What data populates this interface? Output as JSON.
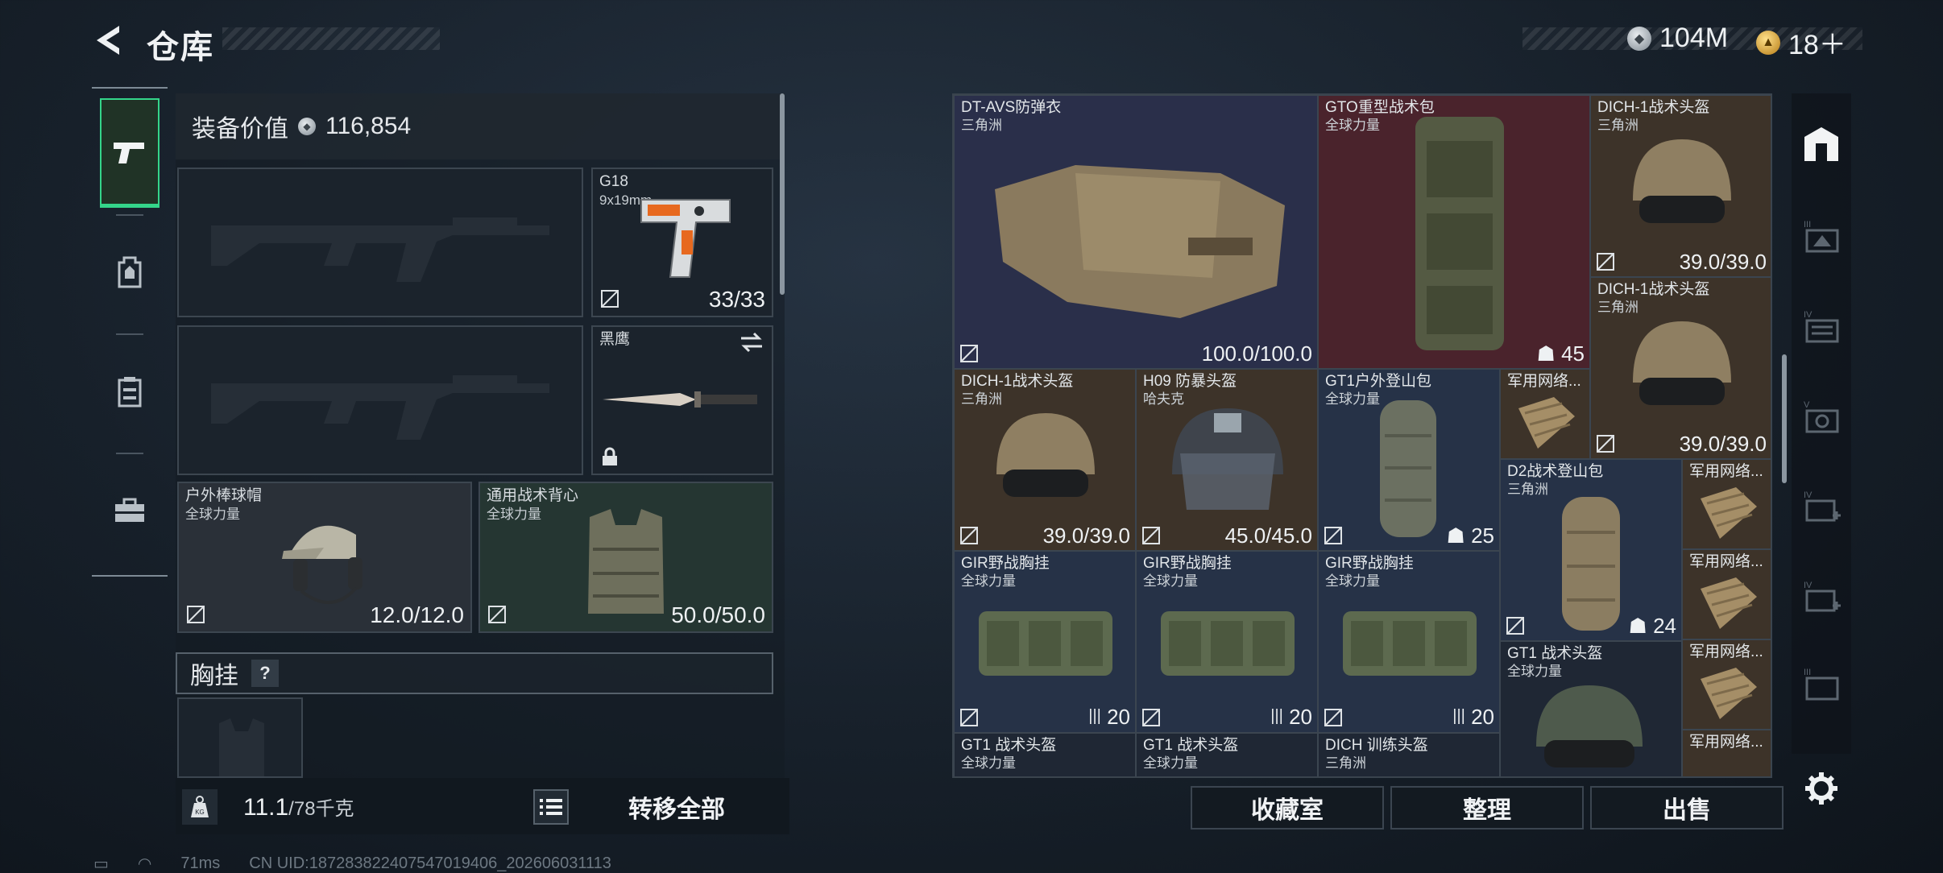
{
  "header": {
    "title": "仓库",
    "currency": [
      {
        "icon": "silver-coin-icon",
        "value": "104M"
      },
      {
        "icon": "gold-coin-icon",
        "value": "18＋"
      }
    ]
  },
  "left_nav": {
    "items": [
      {
        "name": "pistol-icon",
        "active": true
      },
      {
        "name": "backpack-icon",
        "active": false
      },
      {
        "name": "tactical-rig-icon",
        "active": false
      },
      {
        "name": "toolbox-icon",
        "active": false
      }
    ]
  },
  "equipment": {
    "value_label": "装备价值",
    "value": "116,854",
    "pistol": {
      "name": "G18",
      "ammo": "9x19mm",
      "count": "33/33"
    },
    "melee": {
      "name": "黑鹰"
    },
    "helmet": {
      "name": "户外棒球帽",
      "source": "全球力量",
      "durability": "12.0/12.0"
    },
    "armor": {
      "name": "通用战术背心",
      "source": "全球力量",
      "durability": "50.0/50.0"
    },
    "chest_label": "胸挂",
    "chest_help": "?",
    "weight": "11.1",
    "weight_max": "/78千克",
    "transfer_all": "转移全部"
  },
  "inventory": {
    "items": [
      {
        "name": "DT-AVS防弹衣",
        "source": "三角洲",
        "value": "100.0/100.0"
      },
      {
        "name": "GTO重型战术包",
        "source": "全球力量",
        "value": "45"
      },
      {
        "name": "DICH-1战术头盔",
        "source": "三角洲",
        "value": "39.0/39.0"
      },
      {
        "name": "DICH-1战术头盔",
        "source": "三角洲",
        "value": "39.0/39.0"
      },
      {
        "name": "DICH-1战术头盔",
        "source": "三角洲",
        "value": "39.0/39.0"
      },
      {
        "name": "H09 防暴头盔",
        "source": "哈夫克",
        "value": "45.0/45.0"
      },
      {
        "name": "GT1户外登山包",
        "source": "全球力量",
        "value": "25"
      },
      {
        "name": "军用网络...",
        "source": "",
        "value": ""
      },
      {
        "name": "D2战术登山包",
        "source": "三角洲",
        "value": "24"
      },
      {
        "name": "军用网络...",
        "source": "",
        "value": ""
      },
      {
        "name": "GIR野战胸挂",
        "source": "全球力量",
        "value": "20"
      },
      {
        "name": "GIR野战胸挂",
        "source": "全球力量",
        "value": "20"
      },
      {
        "name": "GIR野战胸挂",
        "source": "全球力量",
        "value": "20"
      },
      {
        "name": "军用网络...",
        "source": "",
        "value": ""
      },
      {
        "name": "GT1 战术头盔",
        "source": "全球力量",
        "value": ""
      },
      {
        "name": "军用网络...",
        "source": "",
        "value": ""
      },
      {
        "name": "GT1 战术头盔",
        "source": "全球力量",
        "value": ""
      },
      {
        "name": "GT1 战术头盔",
        "source": "全球力量",
        "value": ""
      },
      {
        "name": "DICH 训练头盔",
        "source": "三角洲",
        "value": ""
      },
      {
        "name": "军用网络...",
        "source": "",
        "value": ""
      }
    ]
  },
  "actions": {
    "collection": "收藏室",
    "sort": "整理",
    "sell": "出售"
  },
  "status": {
    "ping": "71ms",
    "uid": "CN UID:18728382240754701​9406_202606031113"
  }
}
